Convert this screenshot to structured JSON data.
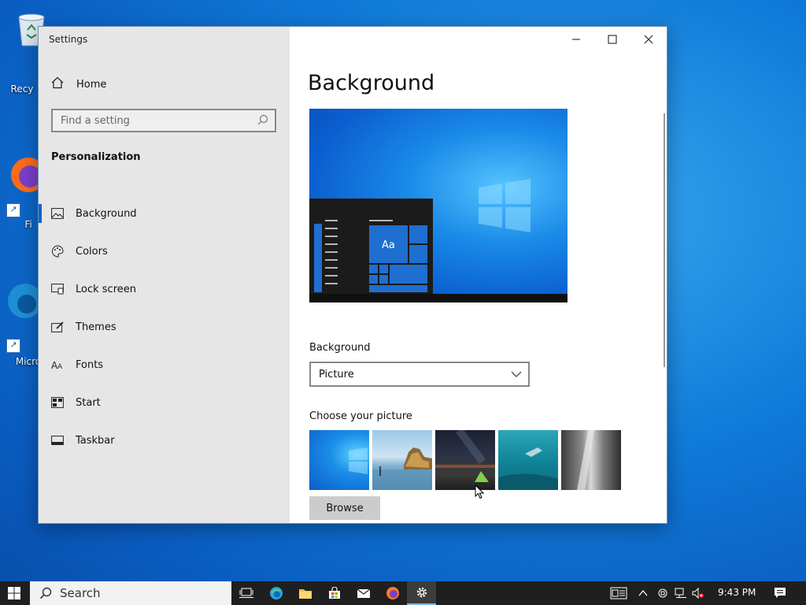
{
  "desktop": {
    "icons": [
      {
        "label": "Recy",
        "icon": "recycle-bin-icon"
      },
      {
        "label": "Fi",
        "icon": "firefox-icon"
      },
      {
        "label": "Micro",
        "icon": "edge-icon"
      }
    ]
  },
  "window": {
    "title": "Settings",
    "controls": {
      "minimize": "—",
      "maximize": "☐",
      "close": "✕"
    },
    "sidebar": {
      "home_label": "Home",
      "search_placeholder": "Find a setting",
      "section_title": "Personalization",
      "items": [
        {
          "label": "Background",
          "icon": "picture-icon",
          "active": true
        },
        {
          "label": "Colors",
          "icon": "palette-icon",
          "active": false
        },
        {
          "label": "Lock screen",
          "icon": "lock-screen-icon",
          "active": false
        },
        {
          "label": "Themes",
          "icon": "themes-icon",
          "active": false
        },
        {
          "label": "Fonts",
          "icon": "fonts-icon",
          "active": false
        },
        {
          "label": "Start",
          "icon": "start-icon",
          "active": false
        },
        {
          "label": "Taskbar",
          "icon": "taskbar-icon",
          "active": false
        }
      ]
    },
    "main": {
      "page_title": "Background",
      "preview_sample_text": "Aa",
      "background_label": "Background",
      "background_value": "Picture",
      "choose_label": "Choose your picture",
      "pictures": [
        "windows-hero",
        "beach-rocks",
        "night-sky-tent",
        "underwater-swimmer",
        "rock-cliff"
      ],
      "browse_label": "Browse"
    }
  },
  "taskbar": {
    "search_label": "Search",
    "apps": [
      "task-view-icon",
      "edge-icon",
      "file-explorer-icon",
      "store-icon",
      "mail-icon",
      "firefox-icon",
      "settings-icon"
    ],
    "active_app": "settings-icon",
    "time": "9:43 PM"
  }
}
